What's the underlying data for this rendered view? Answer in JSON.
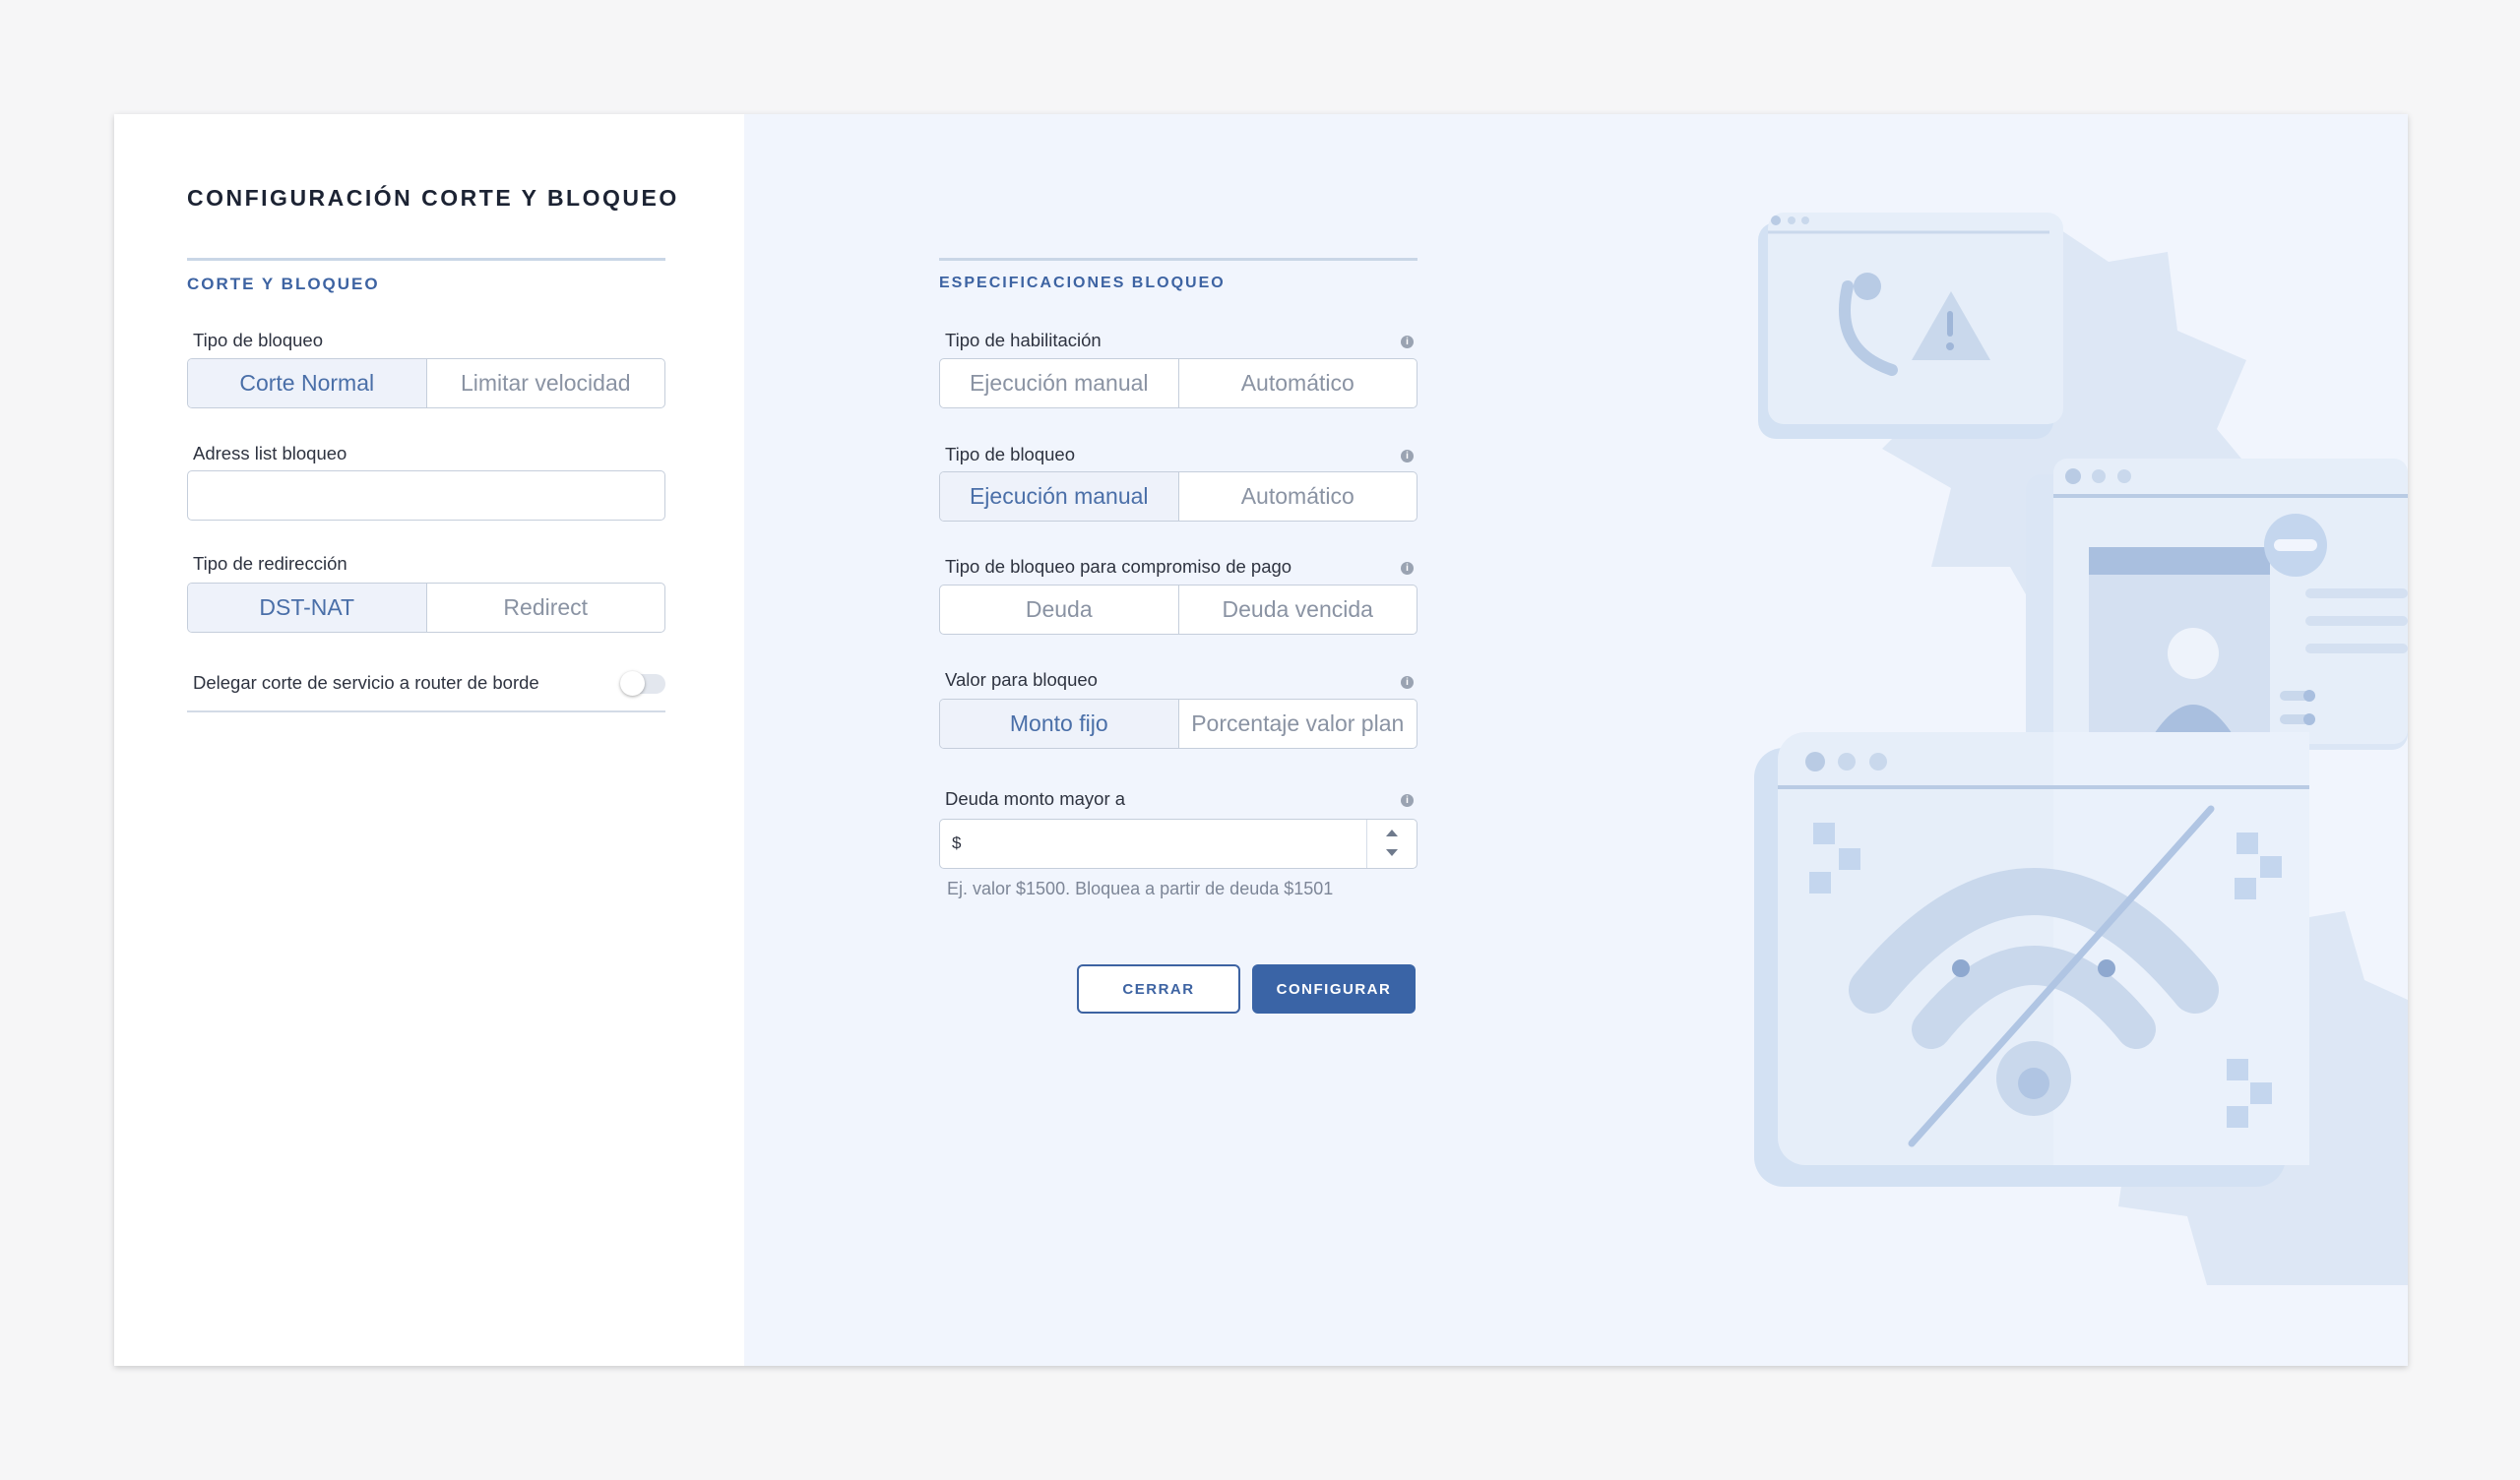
{
  "page": {
    "title": "CONFIGURACIÓN CORTE Y BLOQUEO"
  },
  "corte_bloqueo": {
    "heading": "CORTE Y BLOQUEO",
    "tipo_bloqueo": {
      "label": "Tipo de bloqueo",
      "options": [
        "Corte Normal",
        "Limitar velocidad"
      ],
      "selected": "Corte Normal"
    },
    "address_list": {
      "label": "Adress list bloqueo",
      "value": ""
    },
    "tipo_redireccion": {
      "label": "Tipo de redirección",
      "options": [
        "DST-NAT",
        "Redirect"
      ],
      "selected": "DST-NAT"
    },
    "delegar": {
      "label": "Delegar corte de servicio a router de borde",
      "enabled": false
    }
  },
  "especificaciones": {
    "heading": "ESPECIFICACIONES BLOQUEO",
    "tipo_habilitacion": {
      "label": "Tipo de habilitación",
      "options": [
        "Ejecución manual",
        "Automático"
      ],
      "selected": ""
    },
    "tipo_bloqueo": {
      "label": "Tipo de bloqueo",
      "options": [
        "Ejecución manual",
        "Automático"
      ],
      "selected": "Ejecución manual"
    },
    "compromiso_pago": {
      "label": "Tipo de bloqueo para compromiso de pago",
      "options": [
        "Deuda",
        "Deuda vencida"
      ],
      "selected": ""
    },
    "valor_bloqueo": {
      "label": "Valor para bloqueo",
      "options": [
        "Monto fijo",
        "Porcentaje valor plan"
      ],
      "selected": "Monto fijo"
    },
    "deuda_monto": {
      "label": "Deuda monto mayor a",
      "prefix": "$",
      "value": "",
      "hint": "Ej. valor $1500. Bloquea a partir de deuda $1501"
    },
    "info_icon": "i"
  },
  "actions": {
    "close_label": "CERRAR",
    "configure_label": "CONFIGURAR"
  },
  "colors": {
    "accent": "#3a64a6",
    "panel_bg": "#f1f5fd",
    "illustration": "#d3e1f3"
  }
}
